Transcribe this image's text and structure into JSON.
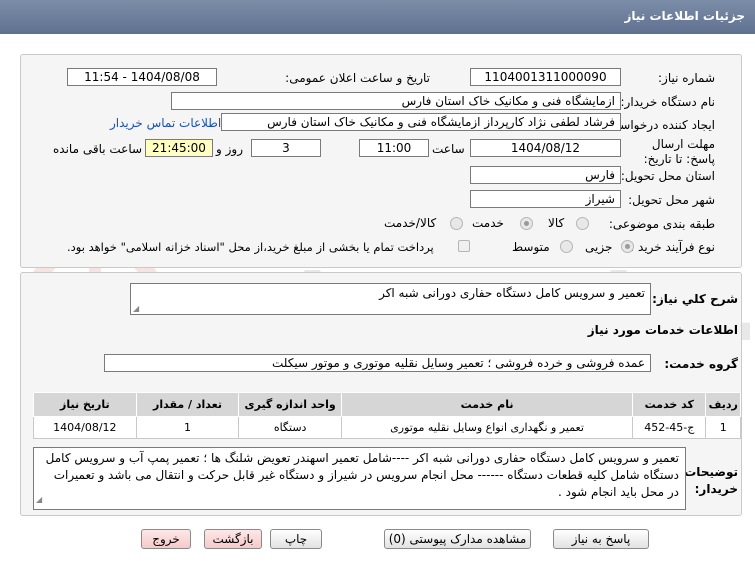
{
  "window": {
    "title": "جزئیات اطلاعات نیاز"
  },
  "watermark": {
    "text": "AriaTender.neT"
  },
  "form": {
    "need_number": {
      "label": "شماره نیاز:",
      "value": "1104001311000090"
    },
    "announce_datetime": {
      "label": "تاریخ و ساعت اعلان عمومی:",
      "value": "1404/08/08 - 11:54"
    },
    "buyer_org": {
      "label": "نام دستگاه خریدار:",
      "value": "ازمایشگاه فنی و مکانیک خاک استان فارس"
    },
    "requester": {
      "label": "ایجاد کننده درخواست:",
      "value": "فرشاد لطفی نژاد کارپرداز ازمایشگاه فنی و مکانیک خاک استان فارس",
      "contact_link": "اطلاعات تماس خریدار"
    },
    "deadline": {
      "label": "مهلت ارسال پاسخ: تا تاریخ:",
      "date": "1404/08/12",
      "time_label": "ساعت",
      "time": "11:00",
      "days": "3",
      "days_label": "روز و",
      "remaining": "21:45:00",
      "remaining_label": "ساعت باقی مانده"
    },
    "delivery_province": {
      "label": "استان محل تحویل:",
      "value": "فارس"
    },
    "delivery_city": {
      "label": "شهر محل تحویل:",
      "value": "شیراز"
    },
    "category": {
      "label": "طبقه بندی موضوعی:",
      "options": [
        "کالا",
        "خدمت",
        "کالا/خدمت"
      ],
      "selected": "خدمت"
    },
    "purchase_type": {
      "label": "نوع فرآیند خرید :",
      "options": [
        "جزیی",
        "متوسط"
      ],
      "selected": "جزیی",
      "treasury_note": "پرداخت تمام یا بخشی از مبلغ خرید،از محل \"اسناد خزانه اسلامی\" خواهد بود."
    }
  },
  "details": {
    "general_desc": {
      "label": "شرح کلي نياز:",
      "value": "تعمیر و سرویس کامل دستگاه حفاری دورانی شبه اکر"
    },
    "services_heading": "اطلاعات خدمات مورد نياز",
    "service_group": {
      "label": "گروه خدمت:",
      "value": "عمده فروشی و خرده فروشی ؛ تعمیر وسایل نقلیه موتوری و موتور سیکلت"
    },
    "table": {
      "columns": [
        "ردیف",
        "کد خدمت",
        "نام خدمت",
        "واحد اندازه گیری",
        "تعداد / مقدار",
        "تاریخ نیاز"
      ],
      "rows": [
        [
          "1",
          "ج-45-452",
          "تعمیر و نگهداری انواع وسایل نقلیه موتوری",
          "دستگاه",
          "1",
          "1404/08/12"
        ]
      ]
    },
    "buyer_notes": {
      "label": "توضیحات خریدار:",
      "value": "تعمیر و سرویس کامل دستگاه حفاری دورانی شبه اکر ----شامل تعمیر اسهندر تعویض شلنگ ها ؛ تعمیر پمپ آب و سرویس کامل دستگاه شامل کلیه قطعات دستگاه ------ محل انجام سرویس در شیراز و دستگاه غیر قابل حرکت و انتقال می باشد و تعمیرات در محل باید انجام شود ."
    }
  },
  "buttons": {
    "reply": "پاسخ به نیاز",
    "attachments": "مشاهده مدارک پیوستی (0)",
    "print": "چاپ",
    "back": "بازگشت",
    "exit": "خروج"
  }
}
